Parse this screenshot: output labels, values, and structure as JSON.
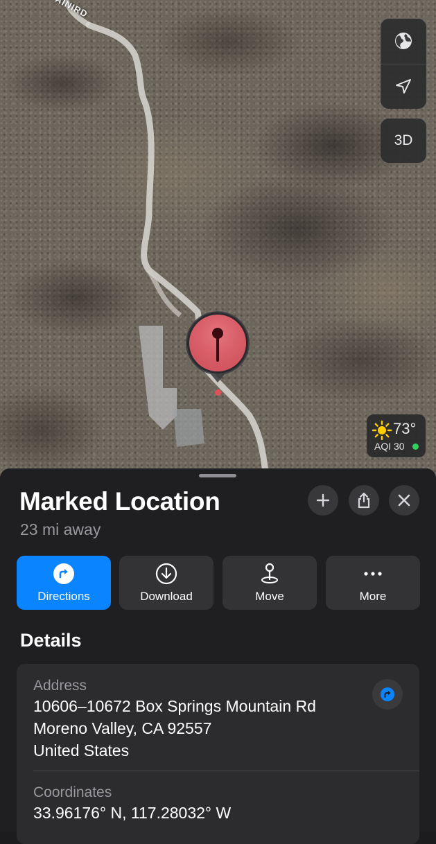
{
  "map": {
    "road_label": "AINIRD",
    "controls": {
      "globe_icon": "globe-icon",
      "location_icon": "location-arrow-icon",
      "three_d_label": "3D"
    },
    "pin_icon": "map-pin-icon",
    "weather": {
      "icon": "sun-icon",
      "temperature": "73°",
      "aqi": "AQI 30",
      "aqi_color": "#2fd15c"
    }
  },
  "sheet": {
    "title": "Marked Location",
    "distance": "23 mi away",
    "header_buttons": [
      "plus-icon",
      "share-icon",
      "close-icon"
    ],
    "actions": [
      {
        "label": "Directions",
        "icon": "directions-icon",
        "color": "#0a84ff"
      },
      {
        "label": "Download",
        "icon": "download-icon"
      },
      {
        "label": "Move",
        "icon": "pin-move-icon"
      },
      {
        "label": "More",
        "icon": "ellipsis-icon"
      }
    ],
    "details": {
      "heading": "Details",
      "address_label": "Address",
      "address_lines": [
        "10606–10672 Box Springs Mountain Rd",
        "Moreno Valley, CA  92557",
        "United States"
      ],
      "coordinates_label": "Coordinates",
      "coordinates": "33.96176° N, 117.28032° W"
    }
  }
}
